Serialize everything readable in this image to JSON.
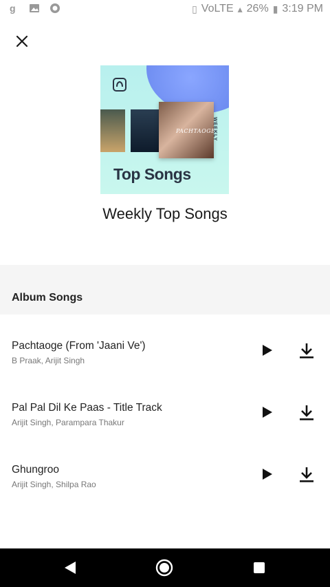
{
  "status_bar": {
    "time": "3:19 PM",
    "battery": "26%",
    "network": "VoLTE"
  },
  "header": {
    "close_icon": "close-icon"
  },
  "cover": {
    "title": "Top Songs",
    "ribbon": "WEEKLY",
    "featured_art_text": "PACHTAOGE"
  },
  "playlist": {
    "title": "Weekly Top Songs"
  },
  "section": {
    "label": "Album Songs"
  },
  "songs": [
    {
      "title": "Pachtaoge (From 'Jaani Ve')",
      "artists": "B Praak, Arijit Singh"
    },
    {
      "title": "Pal Pal Dil Ke Paas - Title Track",
      "artists": "Arijit Singh, Parampara Thakur"
    },
    {
      "title": "Ghungroo",
      "artists": "Arijit Singh, Shilpa Rao"
    }
  ],
  "colors": {
    "background": "#ffffff",
    "section_bg": "#f5f5f5",
    "cover_bg": "#c9f7ee",
    "nav_bar": "#000000"
  }
}
